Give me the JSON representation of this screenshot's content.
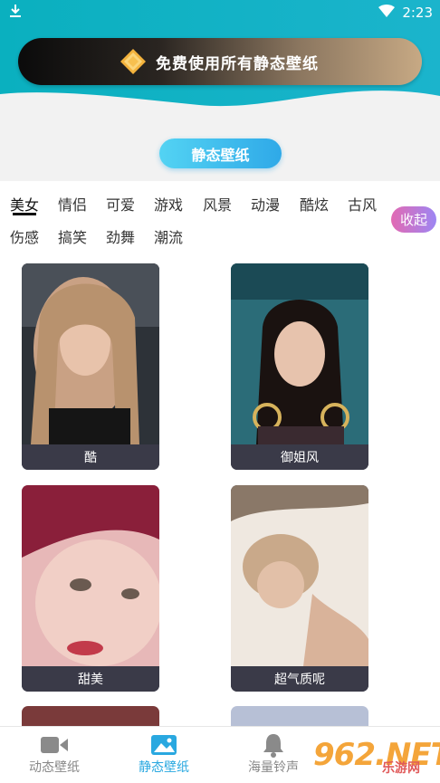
{
  "status_bar": {
    "time": "2:23"
  },
  "banner": {
    "text": "免费使用所有静态壁纸"
  },
  "section_title": "静态壁纸",
  "tabs": [
    "美女",
    "情侣",
    "可爱",
    "游戏",
    "风景",
    "动漫",
    "酷炫",
    "古风",
    "伤感",
    "搞笑",
    "劲舞",
    "潮流"
  ],
  "active_tab": "美女",
  "collapse_label": "收起",
  "wallpapers": [
    {
      "caption": "酷"
    },
    {
      "caption": "御姐风"
    },
    {
      "caption": "甜美"
    },
    {
      "caption": "超气质呢"
    }
  ],
  "bottom_nav": [
    {
      "label": "动态壁纸",
      "icon": "video-icon",
      "active": false
    },
    {
      "label": "静态壁纸",
      "icon": "image-icon",
      "active": true
    },
    {
      "label": "海量铃声",
      "icon": "bell-icon",
      "active": false
    }
  ],
  "watermark": {
    "main": "962.NET",
    "sub": "乐游网"
  },
  "colors": {
    "accent": "#29a8e0",
    "header_teal": "#17b3c4",
    "card_caption": "#3a3a48"
  }
}
